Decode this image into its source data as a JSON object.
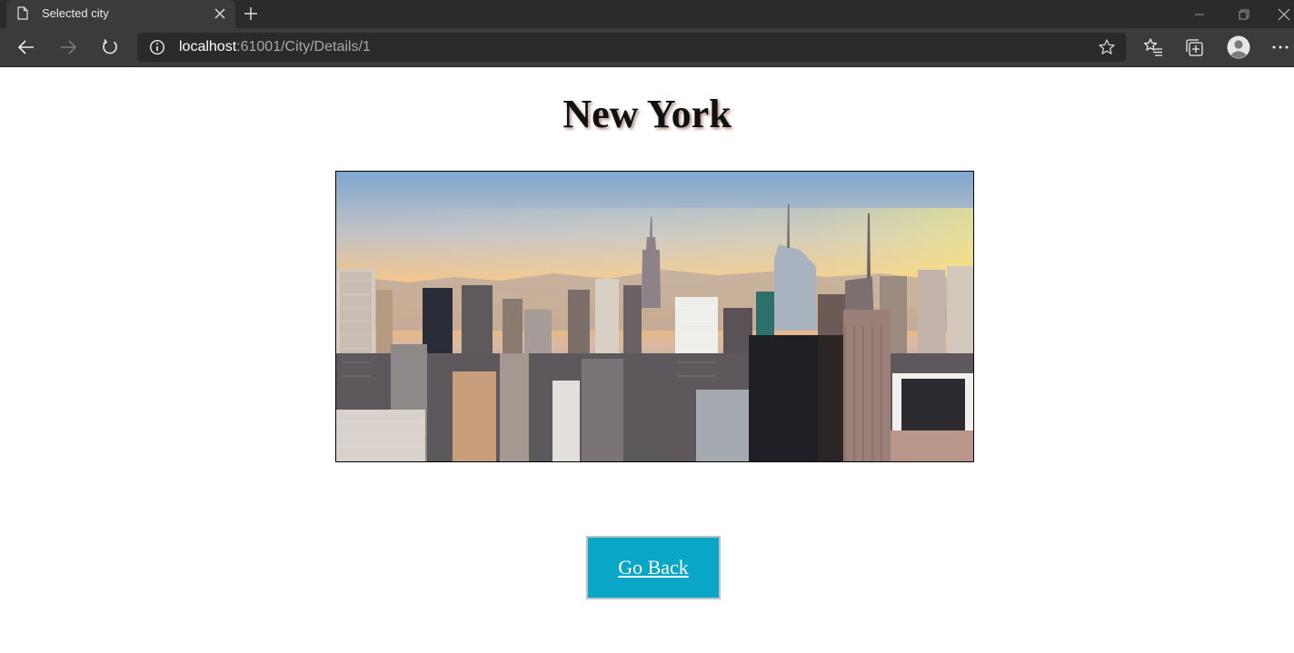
{
  "browser": {
    "tab_title": "Selected city",
    "url_host": "localhost",
    "url_rest": ":61001/City/Details/1"
  },
  "icons": {
    "tab": "document-icon",
    "close": "close-icon",
    "new_tab": "plus-icon",
    "back": "arrow-left-icon",
    "forward": "arrow-right-icon",
    "reload": "reload-icon",
    "site_info": "info-icon",
    "favorite": "star-icon",
    "favorites": "favorites-icon",
    "collections": "collections-icon",
    "profile": "profile-icon",
    "more": "more-icon"
  },
  "page": {
    "title": "New York",
    "image_alt": "New York skyline",
    "go_back_label": "Go Back"
  },
  "colors": {
    "button_bg": "#0aa6c8",
    "chrome_dark": "#2b2b2b",
    "chrome_toolbar": "#3b3b3b"
  }
}
